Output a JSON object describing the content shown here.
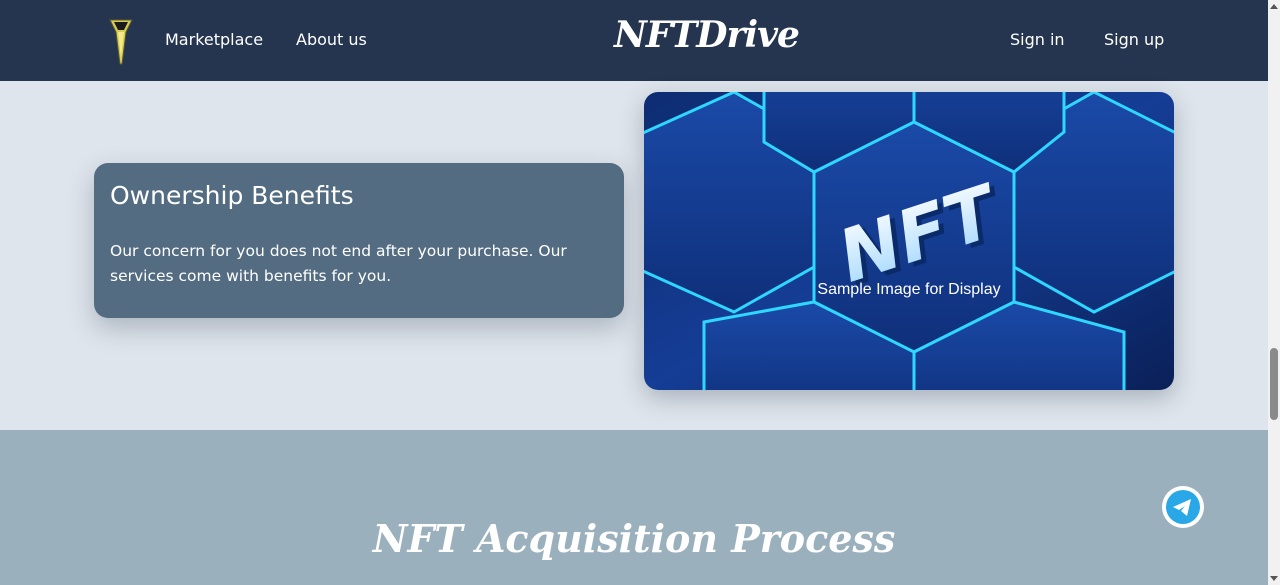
{
  "header": {
    "nav": [
      "Marketplace",
      "About us"
    ],
    "brand": "NFTDrive",
    "auth": {
      "signin": "Sign in",
      "signup": "Sign up"
    }
  },
  "benefits": {
    "title": "Ownership Benefits",
    "text": "Our concern for you does not end after your purchase. Our services come with benefits for you."
  },
  "image": {
    "logo_text": "NFT",
    "caption": "Sample Image for Display"
  },
  "process": {
    "title": "NFT Acquisition Process"
  },
  "colors": {
    "header_bg": "#253550",
    "hero_bg": "#dfe5ec",
    "card_bg": "#536c82",
    "process_bg": "#9bb0bd",
    "neon": "#2fd7ff",
    "telegram": "#2aa7e6"
  },
  "icons": {
    "logo": "shield-logo-icon",
    "telegram": "telegram-icon"
  }
}
